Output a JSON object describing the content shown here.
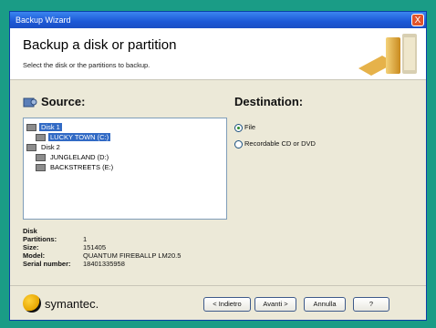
{
  "window": {
    "title": "Backup Wizard",
    "close_label": "X"
  },
  "header": {
    "title": "Backup a disk or partition",
    "subtitle": "Select the disk or the partitions to backup."
  },
  "source": {
    "title": "Source:",
    "tree": [
      {
        "label": "Disk 1",
        "indent": 0,
        "selected": true
      },
      {
        "label": "LUCKY TOWN (C:)",
        "indent": 1,
        "selected": true
      },
      {
        "label": "Disk 2",
        "indent": 0,
        "selected": false
      },
      {
        "label": "JUNGLELAND (D:)",
        "indent": 1,
        "selected": false
      },
      {
        "label": "BACKSTREETS (E:)",
        "indent": 1,
        "selected": false
      }
    ]
  },
  "destination": {
    "title": "Destination:",
    "options": [
      {
        "label": "File",
        "checked": true
      },
      {
        "label": "Recordable CD or DVD",
        "checked": false
      }
    ]
  },
  "info": {
    "heading": "Disk",
    "rows": [
      {
        "key": "Partitions:",
        "value": "1"
      },
      {
        "key": "Size:",
        "value": "151405"
      },
      {
        "key": "Model:",
        "value": "QUANTUM FIREBALLP LM20.5"
      },
      {
        "key": "Serial number:",
        "value": "18401335958"
      }
    ]
  },
  "footer": {
    "brand": "symantec.",
    "buttons": {
      "back": "< Indietro",
      "next": "Avanti >",
      "cancel": "Annulla",
      "help": "?"
    }
  }
}
